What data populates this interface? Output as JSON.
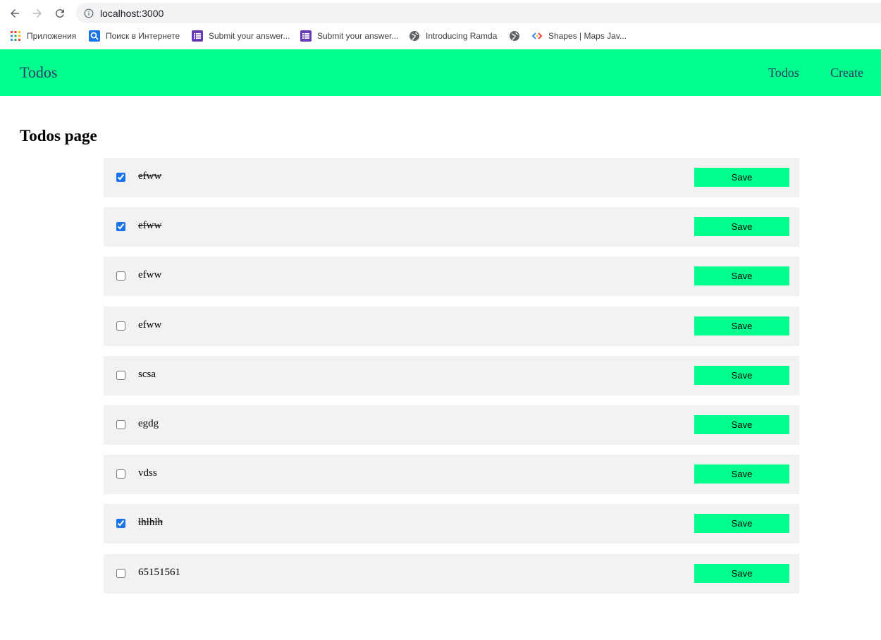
{
  "browser": {
    "url": "localhost:3000",
    "bookmarks": [
      {
        "label": "Приложения",
        "icon": "apps-grid-icon"
      },
      {
        "label": "Поиск в Интернете",
        "icon": "search-icon"
      },
      {
        "label": "Submit your answer...",
        "icon": "form-icon"
      },
      {
        "label": "Submit your answer...",
        "icon": "form-icon"
      },
      {
        "label": "Introducing Ramda",
        "icon": "globe-icon"
      },
      {
        "label": "",
        "icon": "globe-icon"
      },
      {
        "label": "Shapes  |  Maps Jav...",
        "icon": "code-icon"
      }
    ]
  },
  "header": {
    "brand": "Todos",
    "nav": {
      "todos": "Todos",
      "create": "Create"
    },
    "accent_color": "#00ff8c"
  },
  "main": {
    "title": "Todos page",
    "save_label": "Save",
    "todos": [
      {
        "text": "efww",
        "done": true
      },
      {
        "text": "efww",
        "done": true
      },
      {
        "text": "efww",
        "done": false
      },
      {
        "text": "efww",
        "done": false
      },
      {
        "text": "scsa",
        "done": false
      },
      {
        "text": "egdg",
        "done": false
      },
      {
        "text": "vdss",
        "done": false
      },
      {
        "text": "lhlhlh",
        "done": true
      },
      {
        "text": "65151561",
        "done": false
      }
    ]
  }
}
